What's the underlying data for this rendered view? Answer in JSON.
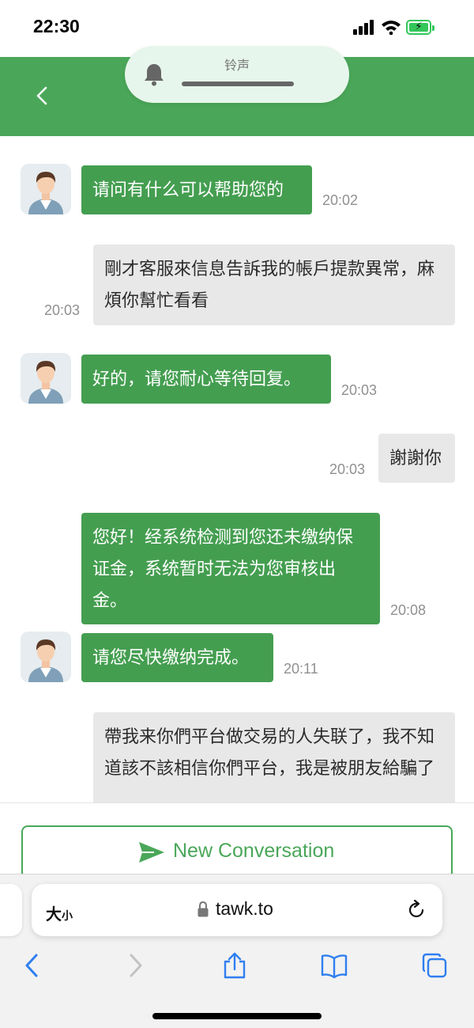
{
  "status_bar": {
    "time": "22:30",
    "battery_icon": "battery-charging-icon",
    "signal_icon": "cellular-signal-icon",
    "wifi_icon": "wifi-icon"
  },
  "colors": {
    "brand_green": "#4aa759",
    "agent_bubble": "#449e50",
    "user_bubble": "#e8e8e8",
    "ring_pill": "#e7f6ec"
  },
  "header": {
    "back_icon": "chevron-left-icon"
  },
  "ringtone_banner": {
    "label": "铃声",
    "icon": "bell-icon"
  },
  "messages": [
    {
      "from": "agent",
      "text": "请问有什么可以帮助您的",
      "time": "20:02"
    },
    {
      "from": "user",
      "text": "剛才客服來信息告訴我的帳戶提款異常，麻煩你幫忙看看",
      "time": "20:03"
    },
    {
      "from": "agent",
      "text": "好的，请您耐心等待回复。",
      "time": "20:03"
    },
    {
      "from": "user",
      "text": "謝謝你",
      "time": "20:03"
    },
    {
      "from": "agent",
      "text": "您好！经系统检测到您还未缴纳保证金，系统暂时无法为您审核出金。",
      "time": "20:08"
    },
    {
      "from": "agent",
      "text": "请您尽快缴纳完成。",
      "time": "20:11"
    },
    {
      "from": "user",
      "text": "帶我来你們平台做交易的人失联了，我不知道該不該相信你們平台，我是被朋友給騙了",
      "time": ""
    }
  ],
  "new_conversation": {
    "label": "New Conversation",
    "icon": "send-icon"
  },
  "safari": {
    "text_size_large": "大",
    "text_size_small": "小",
    "domain": "tawk.to",
    "toolbar": [
      "back-icon",
      "forward-icon",
      "share-icon",
      "bookmarks-icon",
      "tabs-icon"
    ]
  }
}
